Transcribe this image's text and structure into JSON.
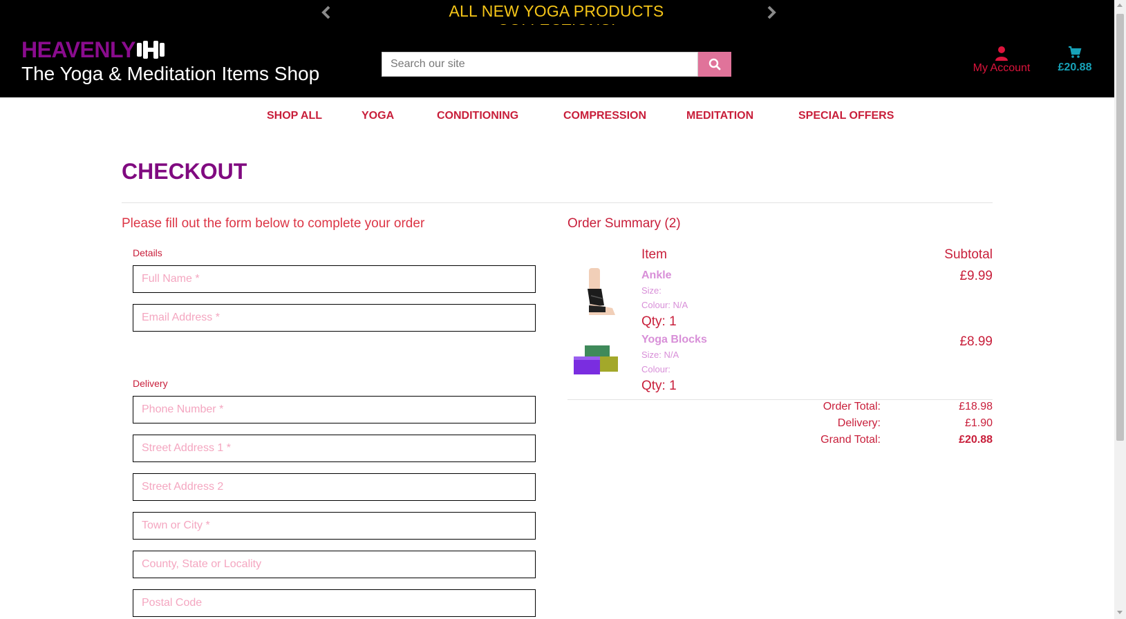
{
  "banner": {
    "text": "ALL NEW YOGA PRODUCTS COLLECTIONS!"
  },
  "header": {
    "brand": "HEAVENLY",
    "tagline": "The Yoga & Meditation Items Shop",
    "search_placeholder": "Search our site",
    "account_label": "My Account",
    "cart_total": "£20.88"
  },
  "nav": {
    "items": [
      "SHOP ALL",
      "YOGA",
      "CONDITIONING",
      "COMPRESSION",
      "MEDITATION",
      "SPECIAL OFFERS"
    ]
  },
  "checkout": {
    "title": "CHECKOUT",
    "intro": "Please fill out the form below to complete your order",
    "details_label": "Details",
    "delivery_label": "Delivery",
    "fields": {
      "full_name": "Full Name *",
      "email": "Email Address *",
      "phone": "Phone Number *",
      "street1": "Street Address 1 *",
      "street2": "Street Address 2",
      "town": "Town or City *",
      "county": "County, State or Locality",
      "postcode": "Postal Code"
    }
  },
  "summary": {
    "title": "Order Summary (2)",
    "col_item": "Item",
    "col_subtotal": "Subtotal",
    "items": [
      {
        "name": "Ankle",
        "size": "Size:",
        "colour": "Colour: N/A",
        "qty": "Qty: 1",
        "price": "£9.99"
      },
      {
        "name": "Yoga Blocks",
        "size": "Size: N/A",
        "colour": "Colour:",
        "qty": "Qty: 1",
        "price": "£8.99"
      }
    ],
    "order_total_label": "Order Total:",
    "order_total": "£18.98",
    "delivery_label": "Delivery:",
    "delivery": "£1.90",
    "grand_total_label": "Grand Total:",
    "grand_total": "£20.88"
  },
  "colors": {
    "banner_text": "#f5c518",
    "brand": "#8a0c8e",
    "accent": "#c81e3a",
    "search_button": "#e0739a",
    "cart": "#17a2b8",
    "product_link": "#d88fd8"
  }
}
